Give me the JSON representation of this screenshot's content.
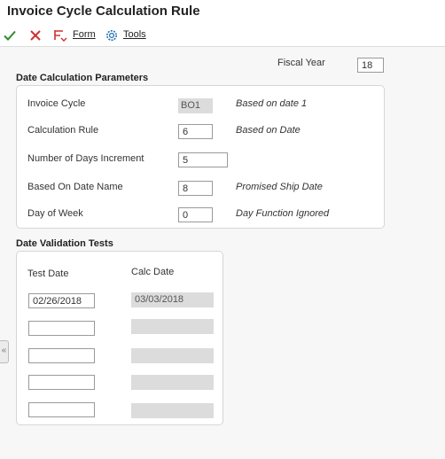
{
  "window": {
    "title": "Invoice Cycle Calculation Rule"
  },
  "toolbar": {
    "form_label": "Form",
    "tools_label": "Tools"
  },
  "header": {
    "fiscal_year_label": "Fiscal Year",
    "fiscal_year_value": "18"
  },
  "date_calc": {
    "section_title": "Date Calculation Parameters",
    "invoice_cycle": {
      "label": "Invoice Cycle",
      "value": "BO1",
      "desc": "Based on date 1"
    },
    "calculation_rule": {
      "label": "Calculation Rule",
      "value": "6",
      "desc": "Based on Date"
    },
    "days_increment": {
      "label": "Number of Days Increment",
      "value": "5"
    },
    "based_on_date_name": {
      "label": "Based On Date Name",
      "value": "8",
      "desc": "Promised Ship Date"
    },
    "day_of_week": {
      "label": "Day of Week",
      "value": "0",
      "desc": "Day Function Ignored"
    }
  },
  "validation": {
    "section_title": "Date Validation Tests",
    "test_date_header": "Test Date",
    "calc_date_header": "Calc Date",
    "rows": [
      {
        "test_date": "02/26/2018",
        "calc_date": "03/03/2018"
      },
      {
        "test_date": "",
        "calc_date": ""
      },
      {
        "test_date": "",
        "calc_date": ""
      },
      {
        "test_date": "",
        "calc_date": ""
      },
      {
        "test_date": "",
        "calc_date": ""
      }
    ]
  },
  "side_tab": {
    "glyph": "«"
  },
  "colors": {
    "ok_green": "#2e8b2e",
    "cancel_red": "#d03030",
    "tools_blue": "#1f6fb2"
  }
}
